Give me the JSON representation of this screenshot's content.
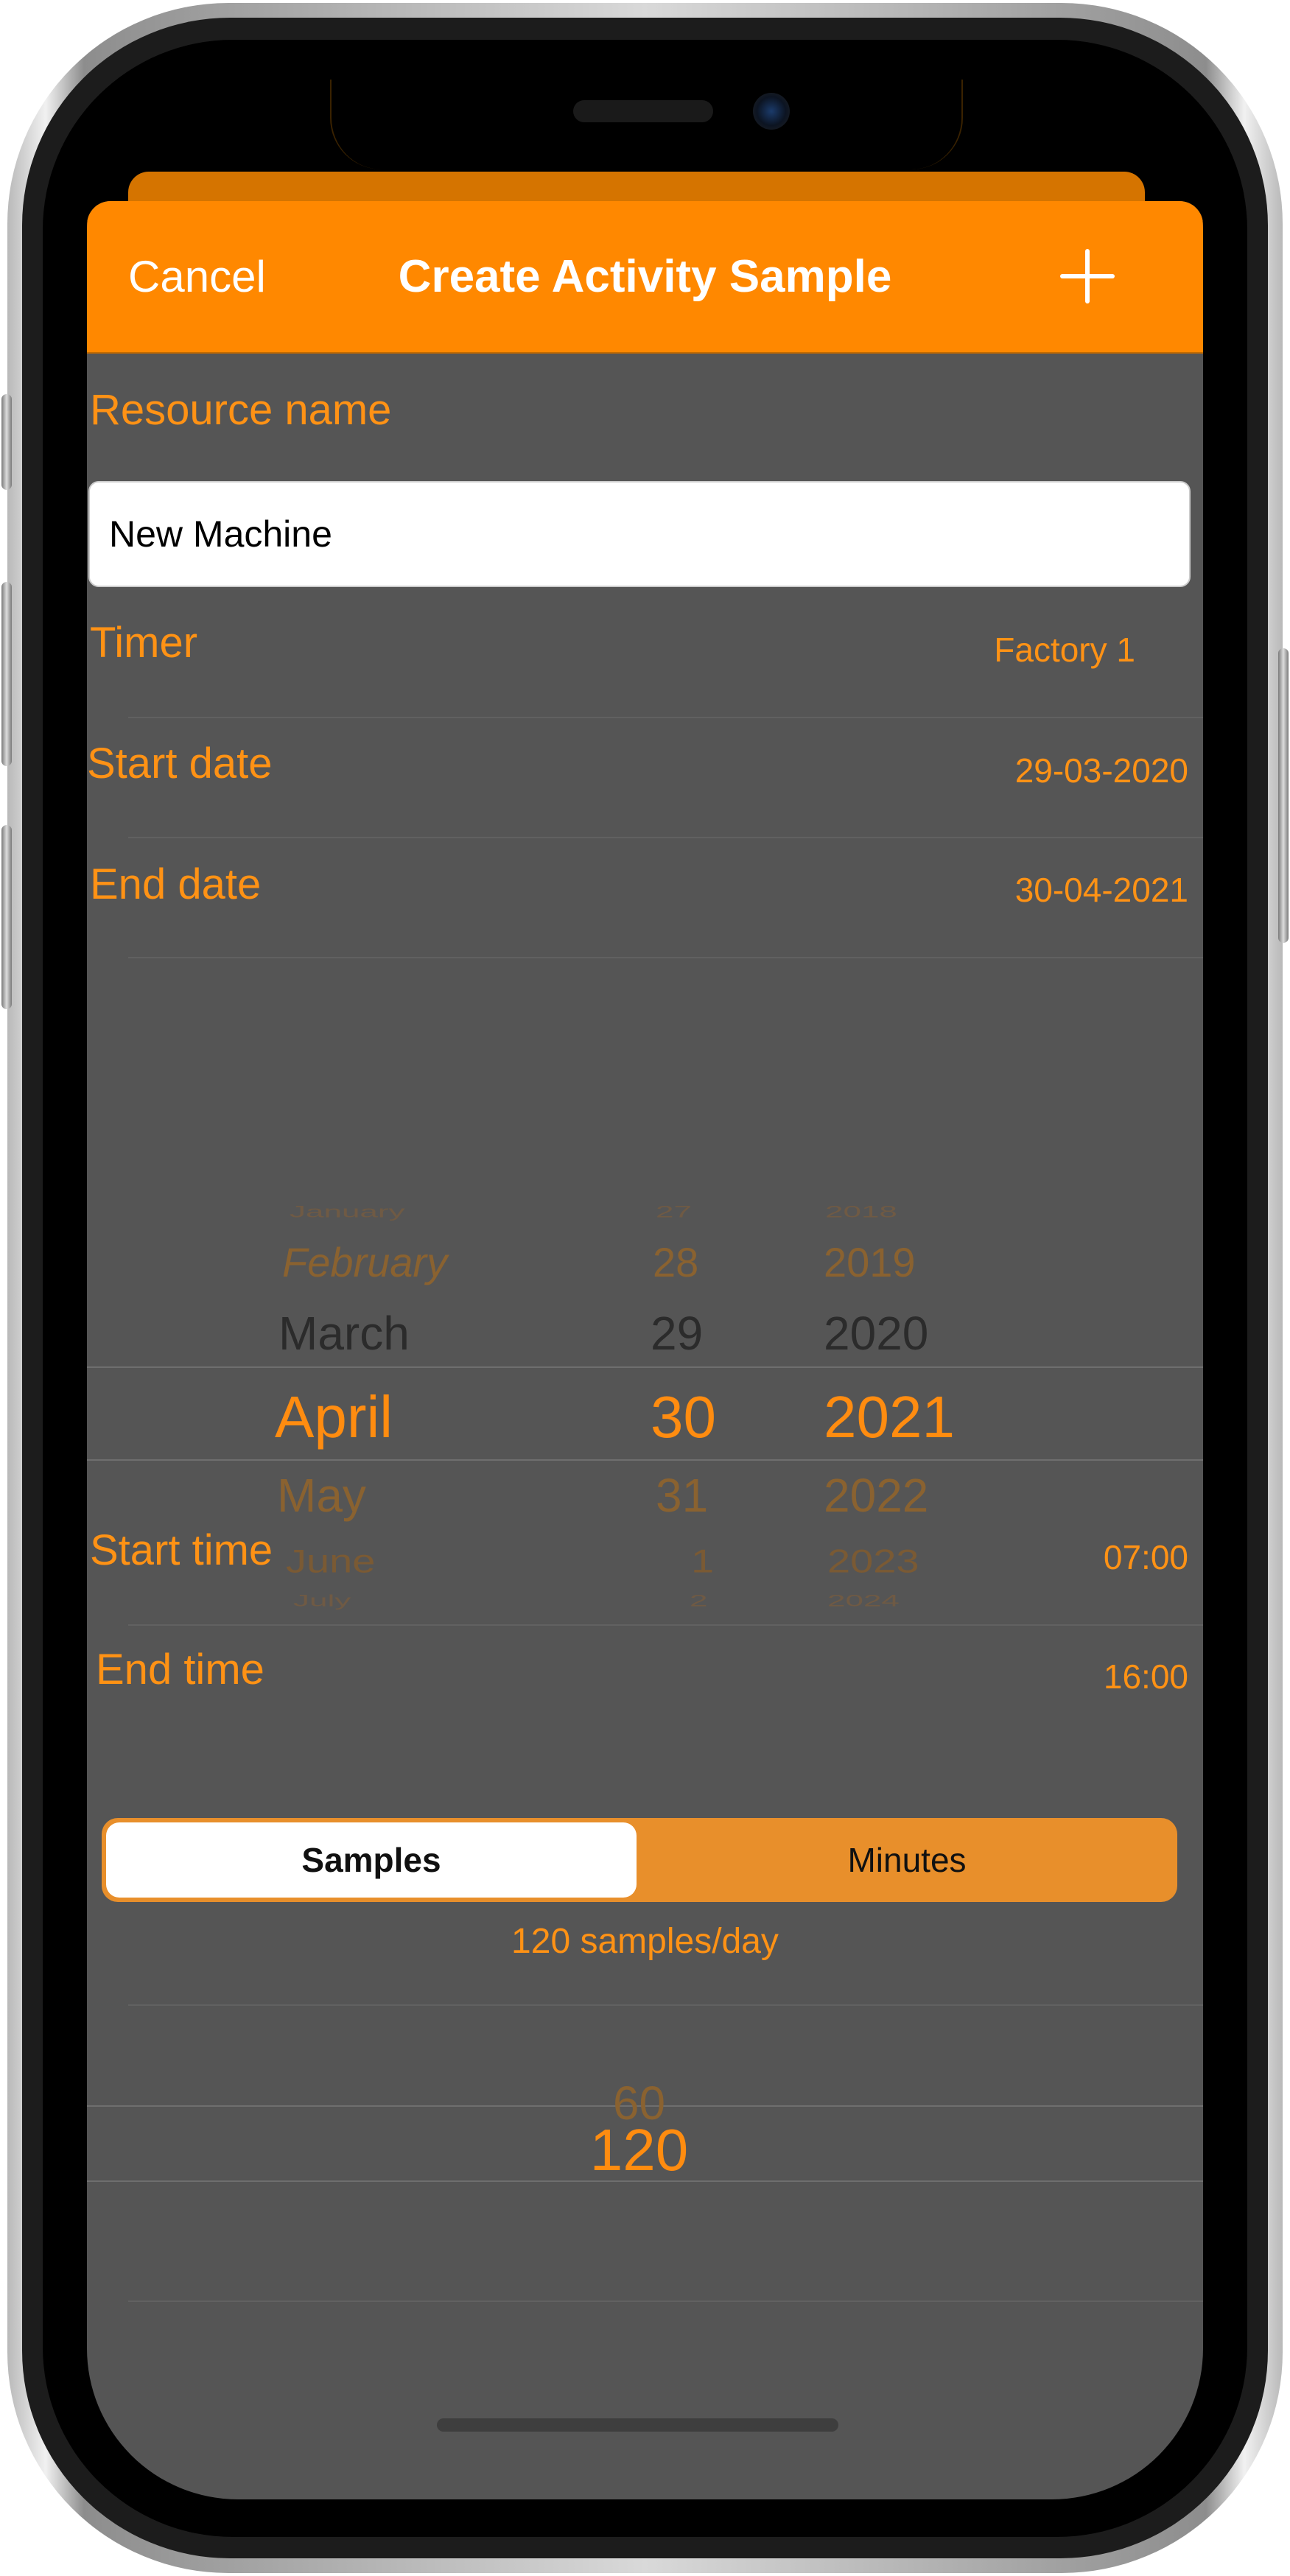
{
  "nav": {
    "cancel": "Cancel",
    "title": "Create Activity Sample",
    "add_icon": "plus-icon"
  },
  "form": {
    "resource_label": "Resource name",
    "resource_value": "New Machine",
    "timer_label": "Timer",
    "timer_value": "Factory 1",
    "start_date_label": "Start date",
    "start_date_value": "29-03-2020",
    "end_date_label": "End date",
    "end_date_value": "30-04-2021",
    "start_time_label": "Start time",
    "start_time_value": "07:00",
    "end_time_label": "End time",
    "end_time_value": "16:00"
  },
  "date_picker": {
    "months": [
      "January",
      "February",
      "March",
      "April",
      "May",
      "June",
      "July"
    ],
    "days": [
      "27",
      "28",
      "29",
      "30",
      "31",
      "1",
      "2"
    ],
    "years": [
      "2018",
      "2019",
      "2020",
      "2021",
      "2022",
      "2023",
      "2024"
    ],
    "selected_index": 3
  },
  "segment": {
    "options": [
      "Samples",
      "Minutes"
    ],
    "selected": "Samples"
  },
  "samples_info": "120 samples/day",
  "count_picker": {
    "items": [
      "60",
      "120"
    ],
    "selected": "120"
  },
  "colors": {
    "accent": "#ff8800",
    "label": "#ff9215",
    "background": "#555555"
  }
}
